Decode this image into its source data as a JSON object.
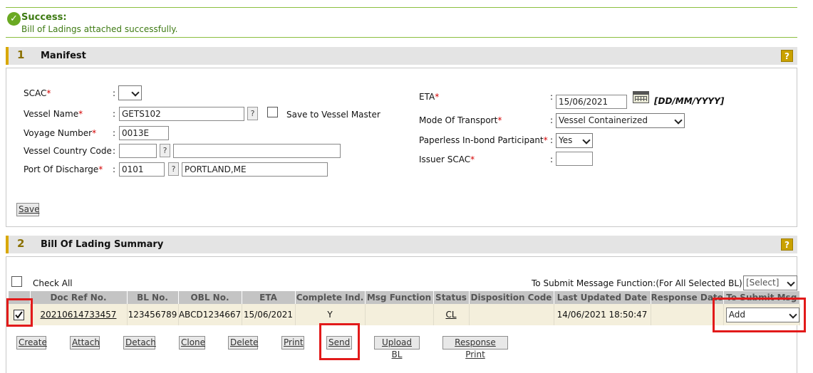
{
  "banner": {
    "title": "Success:",
    "message": "Bill of Ladings attached successfully.",
    "color": "#3d7a12"
  },
  "manifest": {
    "number": "1",
    "title": "Manifest",
    "help": "?",
    "scac_label": "SCAC",
    "scac_value": "",
    "vessel_name_label": "Vessel Name",
    "vessel_name_value": "GETS102",
    "save_to_master_label": "Save to Vessel Master",
    "voyage_label": "Voyage Number",
    "voyage_value": "0013E",
    "country_label": "Vessel Country Code",
    "country_code": "",
    "country_name": "",
    "port_label": "Port Of Discharge",
    "port_code": "0101",
    "port_name": "PORTLAND,ME",
    "eta_label": "ETA",
    "eta_value": "15/06/2021",
    "eta_format": "[DD/MM/YYYY]",
    "mode_label": "Mode Of Transport",
    "mode_value": "Vessel Containerized",
    "paperless_label": "Paperless In-bond Participant",
    "paperless_value": "Yes",
    "issuer_label": "Issuer SCAC",
    "issuer_value": "",
    "save_label": "Save",
    "q": "?",
    "asterisk": "*",
    "colon": ":"
  },
  "bol": {
    "number": "2",
    "title": "Bill Of Lading Summary",
    "help": "?",
    "check_all_label": "Check All",
    "submit_fn_label": "To Submit Message Function:(For All Selected BL)",
    "submit_fn_select": "[Select]",
    "columns": [
      "Doc Ref No.",
      "BL No.",
      "OBL No.",
      "ETA",
      "Complete Ind.",
      "Msg Function",
      "Status",
      "Disposition Code",
      "Last Updated Date",
      "Response Date",
      "To Submit Msg"
    ],
    "row": {
      "checked": true,
      "doc_ref": "20210614733457",
      "bl_no": "123456789",
      "obl_no": "ABCD1234667",
      "eta": "15/06/2021",
      "complete": "Y",
      "msg_function": "",
      "status": "CL",
      "disposition": "",
      "last_updated": "14/06/2021 18:50:47",
      "response": "",
      "to_submit": "Add"
    },
    "buttons": {
      "create": "Create",
      "attach": "Attach",
      "detach": "Detach",
      "clone": "Clone",
      "delete": "Delete",
      "print": "Print",
      "send": "Send",
      "upload": "Upload BL",
      "response_print": "Response Print"
    }
  },
  "colors": {
    "accent": "#d9a800",
    "highlight_box": "#e21a1a",
    "success_border": "#8cbf3f"
  }
}
